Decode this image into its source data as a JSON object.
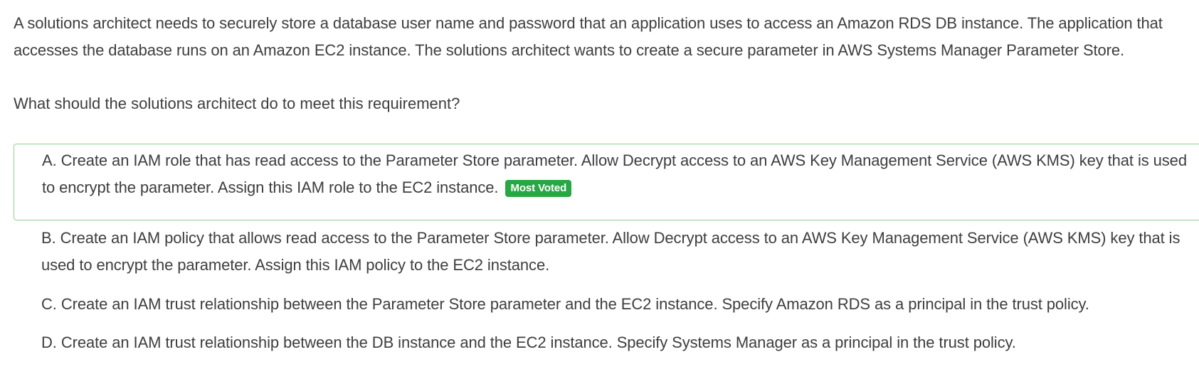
{
  "question": {
    "text": "A solutions architect needs to securely store a database user name and password that an application uses to access an Amazon RDS DB instance. The application that accesses the database runs on an Amazon EC2 instance. The solutions architect wants to create a secure parameter in AWS Systems Manager Parameter Store.",
    "prompt": "What should the solutions architect do to meet this requirement?"
  },
  "choices": [
    {
      "letter": "A.",
      "text": "Create an IAM role that has read access to the Parameter Store parameter. Allow Decrypt access to an AWS Key Management Service (AWS KMS) key that is used to encrypt the parameter. Assign this IAM role to the EC2 instance.",
      "badge": "Most Voted"
    },
    {
      "letter": "B.",
      "text": "Create an IAM policy that allows read access to the Parameter Store parameter. Allow Decrypt access to an AWS Key Management Service (AWS KMS) key that is used to encrypt the parameter. Assign this IAM policy to the EC2 instance."
    },
    {
      "letter": "C.",
      "text": "Create an IAM trust relationship between the Parameter Store parameter and the EC2 instance. Specify Amazon RDS as a principal in the trust policy."
    },
    {
      "letter": "D.",
      "text": "Create an IAM trust relationship between the DB instance and the EC2 instance. Specify Systems Manager as a principal in the trust policy."
    }
  ],
  "colors": {
    "text": "#3e3e3e",
    "selected_border": "#8fd18f",
    "badge_background": "#28a745",
    "badge_text": "#ffffff"
  }
}
